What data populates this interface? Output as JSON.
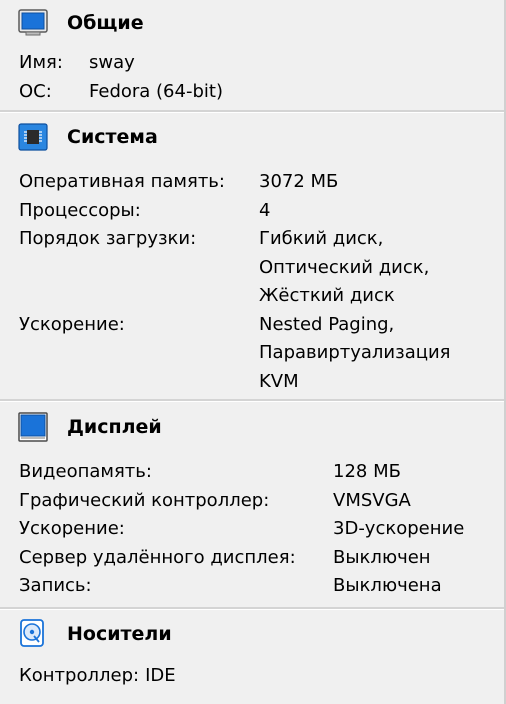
{
  "general": {
    "title": "Общие",
    "icon": "monitor-icon",
    "rows": [
      {
        "key": "Имя:",
        "value": "sway"
      },
      {
        "key": "ОС:",
        "value": "Fedora (64-bit)"
      }
    ]
  },
  "system": {
    "title": "Система",
    "icon": "chip-icon",
    "ram_key": "Оперативная память:",
    "ram_value": "3072 МБ",
    "cpu_key": "Процессоры:",
    "cpu_value": "4",
    "boot_key": "Порядок загрузки:",
    "boot_values": [
      "Гибкий диск,",
      "Оптический диск,",
      "Жёсткий диск"
    ],
    "accel_key": "Ускорение:",
    "accel_values": [
      "Nested Paging,",
      "Паравиртуализация",
      "KVM"
    ]
  },
  "display": {
    "title": "Дисплей",
    "icon": "display-icon",
    "rows": [
      {
        "key": "Видеопамять:",
        "value": "128 МБ"
      },
      {
        "key": "Графический контроллер:",
        "value": "VMSVGA"
      },
      {
        "key": "Ускорение:",
        "value": "3D-ускорение"
      },
      {
        "key": "Сервер удалённого дисплея:",
        "value": "Выключен"
      },
      {
        "key": "Запись:",
        "value": "Выключена"
      }
    ]
  },
  "storage": {
    "title": "Носители",
    "icon": "disk-icon",
    "controller_key": "Контроллер:",
    "controller_value": "IDE"
  },
  "colors": {
    "background": "#f0f0f0",
    "separator": "#d4d4d4",
    "icon_blue": "#1a73d9"
  }
}
